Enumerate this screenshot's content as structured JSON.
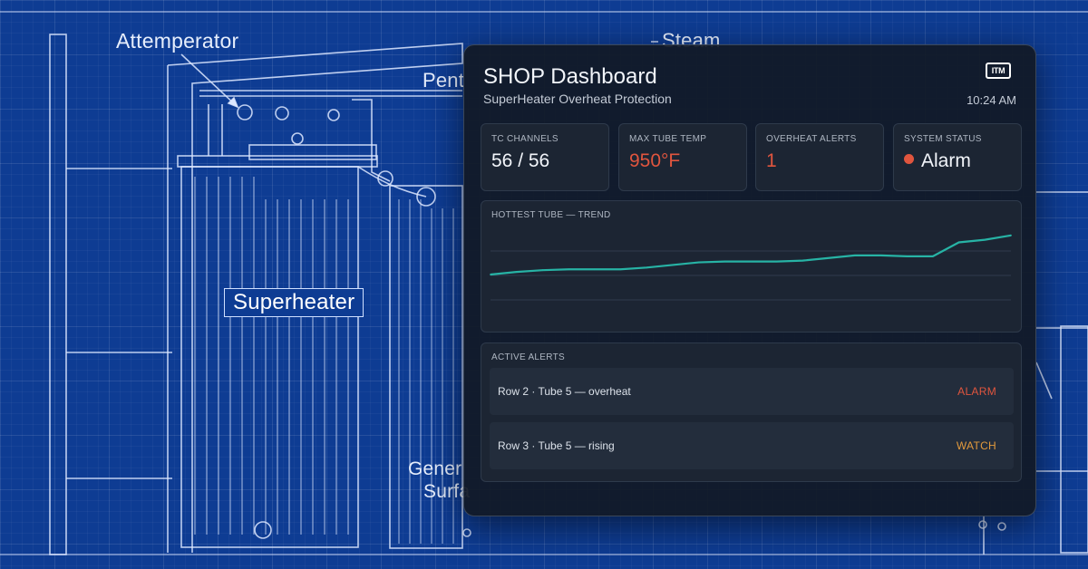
{
  "background": {
    "labels": {
      "attemperator": "Attemperator",
      "steam": "Steam",
      "pent": "Pent",
      "superheater": "Superheater",
      "gener": "Gener",
      "surfa": "Surfa"
    }
  },
  "dashboard": {
    "title": "SHOP Dashboard",
    "subtitle": "SuperHeater Overheat Protection",
    "logo": "ITM",
    "time": "10:24 AM",
    "cards": [
      {
        "label": "TC CHANNELS",
        "value": "56 / 56"
      },
      {
        "label": "MAX TUBE TEMP",
        "value": "950°F"
      },
      {
        "label": "OVERHEAT ALERTS",
        "value": "1"
      },
      {
        "label": "SYSTEM STATUS",
        "value": "Alarm"
      }
    ],
    "trend": {
      "label": "HOTTEST TUBE — TREND",
      "line_color": "#27b3a5"
    },
    "alerts": {
      "label": "ACTIVE ALERTS",
      "rows": [
        {
          "text": "Row 2 · Tube 5 — overheat",
          "badge": "ALARM"
        },
        {
          "text": "Row 3 · Tube 5 — rising",
          "badge": "WATCH"
        }
      ]
    }
  },
  "colors": {
    "alarm": "#e0553e",
    "watch": "#e29a3c",
    "blueprint": "#0e3c93"
  },
  "chart_data": {
    "type": "line",
    "title": "HOTTEST TUBE — TREND",
    "x": [
      0,
      1,
      2,
      3,
      4,
      5,
      6,
      7,
      8,
      9,
      10,
      11,
      12,
      13,
      14,
      15,
      16,
      17,
      18,
      19,
      20
    ],
    "series": [
      {
        "values": [
          0.0,
          0.06,
          0.1,
          0.12,
          0.12,
          0.12,
          0.16,
          0.22,
          0.28,
          0.3,
          0.3,
          0.3,
          0.32,
          0.38,
          0.44,
          0.44,
          0.42,
          0.42,
          0.74,
          0.8,
          0.9
        ]
      }
    ],
    "grid": true
  }
}
